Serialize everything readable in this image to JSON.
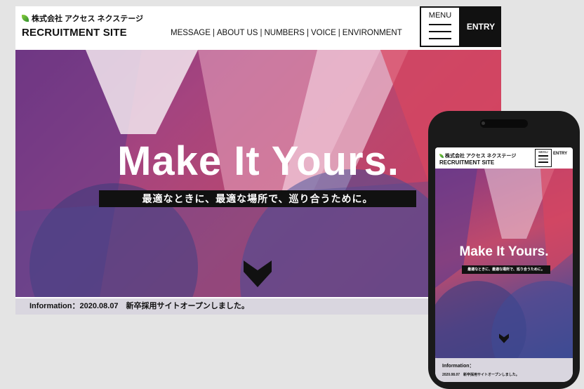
{
  "desktop": {
    "company_name": "株式会社 アクセス ネクステージ",
    "site_name": "RECRUITMENT SITE",
    "nav": [
      "MESSAGE",
      "ABOUT US",
      "NUMBERS",
      "VOICE",
      "ENVIRONMENT"
    ],
    "nav_separator": "|",
    "menu_label": "MENU",
    "entry_label": "ENTRY",
    "hero_title": "Make It Yours.",
    "hero_subtitle": "最適なときに、最適な場所で、巡り合うために。",
    "info_text": "Information：2020.08.07　新卒採用サイトオープンしました。"
  },
  "mobile": {
    "company_name": "株式会社 アクセス ネクステージ",
    "site_name": "RECRUITMENT SITE",
    "menu_label": "MENU",
    "entry_label": "ENTRY",
    "hero_title": "Make It Yours.",
    "hero_subtitle": "最適なときに、最適な場所で、巡り合うために。",
    "info_label": "Information：",
    "info_text": "2020.08.07　新卒採用サイトオープンしました。"
  },
  "colors": {
    "background": "#e4e4e4",
    "header_bg": "#ffffff",
    "text": "#111111",
    "entry_bg": "#111111",
    "hero_magenta": "#c24a6b",
    "hero_purple": "#7a2f7d",
    "hero_blue": "#3e4a8f",
    "info_bar": "#d9d6df"
  },
  "icons": [
    "leaf-logo-icon",
    "hamburger-menu-icon",
    "scroll-down-chevron-icon"
  ]
}
